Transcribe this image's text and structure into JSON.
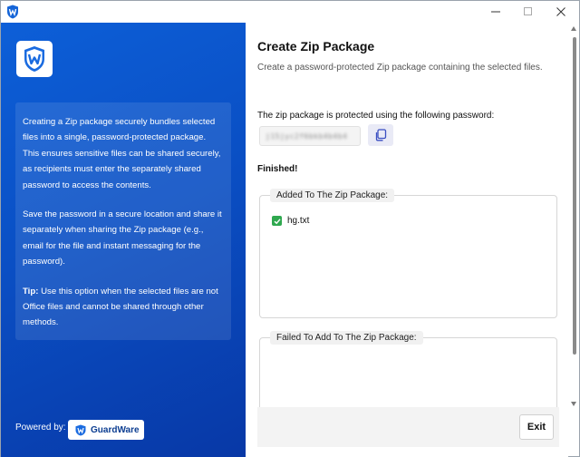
{
  "window": {
    "controls": {
      "minimize_icon": "minimize-icon",
      "maximize_icon": "maximize-icon",
      "close_icon": "close-icon"
    }
  },
  "sidebar": {
    "info_paragraphs": [
      "Creating a Zip package securely bundles selected files into a single, password-protected package. This ensures sensitive files can be shared securely, as recipients must enter the separately shared password to access the contents.",
      "Save the password in a secure location and share it separately when sharing the Zip package (e.g., email for the file and instant messaging for the password)."
    ],
    "tip_label": "Tip:",
    "tip_text": " Use this option when the selected files are not Office files and cannot be shared through other methods.",
    "powered_by": "Powered by:",
    "brand": "GuardWare"
  },
  "main": {
    "title": "Create Zip Package",
    "subtitle": "Create a password-protected Zip package containing the selected files.",
    "password_label": "The zip package is protected using the following password:",
    "password_value": "j15jyc2f6bkb4b4b4",
    "status": "Finished!",
    "added_group": {
      "legend": "Added To The Zip Package:",
      "files": [
        "hg.txt"
      ]
    },
    "failed_group": {
      "legend": "Failed To Add To The Zip Package:",
      "files": []
    },
    "exit_label": "Exit"
  },
  "colors": {
    "sidebar_blue": "#0a4fc4",
    "success_green": "#2fa84f",
    "copy_button_bg": "#e9eaf6"
  }
}
